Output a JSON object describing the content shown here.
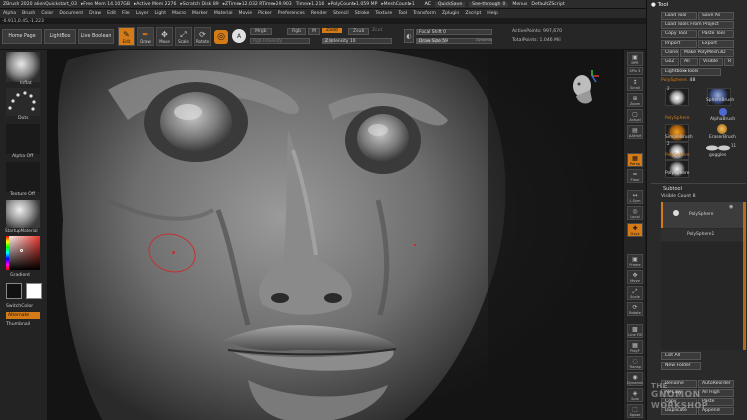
{
  "titlebar": {
    "items": [
      "ZBrush 2020 alienQuickstart_03",
      "▸Free Mem 14.107GB",
      "▸Active Mem 2276",
      "▸Scratch Disk 89",
      "▸ZTime▸12.032 RTime▸29.903",
      "Timer▸1.216",
      "▸PolyCount▸1.059 MP",
      "▸MeshCount▸1"
    ],
    "ac": "AC",
    "quicksave": "QuickSave",
    "seethrough": "See-through",
    "seethrough_value": "0",
    "menus_label": "Menus",
    "script": "DefaultZScript"
  },
  "menubar": {
    "items": [
      "Alpha",
      "Brush",
      "Color",
      "Document",
      "Draw",
      "Edit",
      "File",
      "Layer",
      "Light",
      "Macro",
      "Marker",
      "Material",
      "Movie",
      "Picker",
      "Preferences",
      "Render",
      "Stencil",
      "Stroke",
      "Texture",
      "Tool",
      "Transform",
      "Zplugin",
      "Zscript",
      "Help"
    ]
  },
  "coords": "-0.911,0.45,-1.223",
  "shelf": {
    "home_page": "Home Page",
    "lightbox": "LightBox",
    "live_boolean": "Live Boolean",
    "tools": [
      {
        "label": "Edit",
        "icon": "✎",
        "on": true
      },
      {
        "label": "Draw",
        "icon": "✒",
        "on": true
      },
      {
        "label": "Move",
        "icon": "✥",
        "on": false
      },
      {
        "label": "Scale",
        "icon": "⤢",
        "on": false
      },
      {
        "label": "Rotate",
        "icon": "⟳",
        "on": false
      }
    ],
    "a_label": "A",
    "mrgb": "Mrgb",
    "rgb": "Rgb",
    "m": "M",
    "zadd": "Zadd",
    "zsub": "Zsub",
    "zcut": "Zcut",
    "rgb_intensity": "Rgb Intensity",
    "z_intensity_label": "Z Intensity",
    "z_intensity_value": "10",
    "focal_shift_label": "Focal Shift",
    "focal_shift_value": "0",
    "draw_size_label": "Draw Size",
    "draw_size_value": "59",
    "dynamic": "Dynamic",
    "active_points_label": "ActivePoints:",
    "active_points_value": "997,670",
    "total_points_label": "TotalPoints:",
    "total_points_value": "1.046 Mil"
  },
  "left_tray": {
    "brush": "Inflat",
    "stroke": "Dots",
    "alpha": "Alpha Off",
    "texture": "Texture Off",
    "material": "StartupMaterial",
    "gradient": "Gradient",
    "switch_color": "SwitchColor",
    "alternate": "Alternate",
    "thumbnail": "Thumbnail"
  },
  "right_strip": [
    {
      "label": "BPR",
      "icon": "▣"
    },
    {
      "label": "SPix",
      "value": "3"
    },
    {
      "label": "Scroll",
      "icon": "↕"
    },
    {
      "label": "Zoom",
      "icon": "⊕"
    },
    {
      "label": "Actual",
      "icon": "▢"
    },
    {
      "label": "AAHalf",
      "icon": "▤"
    },
    {
      "label": "Persp",
      "icon": "▦",
      "on": true
    },
    {
      "label": "Floor",
      "icon": "═"
    },
    {
      "label": "L.Sym",
      "icon": "↔"
    },
    {
      "label": "Local",
      "icon": "◎"
    },
    {
      "label": "Gxyz",
      "icon": "✚",
      "on": true
    },
    {
      "label": "Frame",
      "icon": "▣"
    },
    {
      "label": "Move",
      "icon": "✥"
    },
    {
      "label": "Scale",
      "icon": "⤢"
    },
    {
      "label": "Rotate",
      "icon": "⟳"
    },
    {
      "label": "Line Fill",
      "icon": "▩"
    },
    {
      "label": "PolyF",
      "icon": "▦"
    },
    {
      "label": "Transp",
      "icon": "◌"
    },
    {
      "label": "Dynamic",
      "icon": "◉"
    },
    {
      "label": "Solo",
      "icon": "◈"
    },
    {
      "label": "Xpose",
      "icon": "⬚"
    }
  ],
  "palette": {
    "title": "Tool",
    "load_tool": "Load Tool",
    "save_as": "Save As",
    "load_from_project": "Load Tools From Project",
    "copy_tool": "Copy Tool",
    "paste_tool": "Paste Tool",
    "import": "Import",
    "export": "Export",
    "clone": "Clone",
    "make_polymesh": "Make PolyMesh3D",
    "goz": "GoZ",
    "all": "All",
    "visible": "Visible",
    "r": "R",
    "lightbox_tools": "Lightbox▸Tools",
    "current_tool_label": "PolySphere.",
    "current_tool_value": "48",
    "thumbs": [
      {
        "name": "PolySphere",
        "badge": "2"
      },
      {
        "name": "SphereBrush",
        "badge": ""
      },
      {
        "name": "AlphaBrush",
        "badge": ""
      },
      {
        "name": "SimpleBrush",
        "badge": ""
      },
      {
        "name": "EraserBrush",
        "badge": ""
      },
      {
        "name": "PolySphere",
        "badge": "2"
      },
      {
        "name": "goggles",
        "badge": "11"
      },
      {
        "name": "PolySphere",
        "badge": ""
      }
    ],
    "subtool_title": "Subtool",
    "visible_count": "Visible Count 8",
    "subtools": [
      "PolySphere",
      "PolySphere1"
    ],
    "list_all": "List All",
    "new_folder": "New Folder",
    "rename": "Rename",
    "autoreorder": "AutoReorder",
    "all_low": "All Low",
    "all_high": "All High",
    "copy": "Copy",
    "paste": "Paste",
    "duplicate": "Duplicate",
    "append": "Append",
    "insert": "Insert"
  },
  "watermark": [
    "THE",
    "GNOMON",
    "WORKSHOP"
  ],
  "colors": {
    "accent": "#d47a16",
    "panel": "#2a2a2a",
    "viewport_bg": "#1a1a1a",
    "current_color": "#e8362b"
  }
}
